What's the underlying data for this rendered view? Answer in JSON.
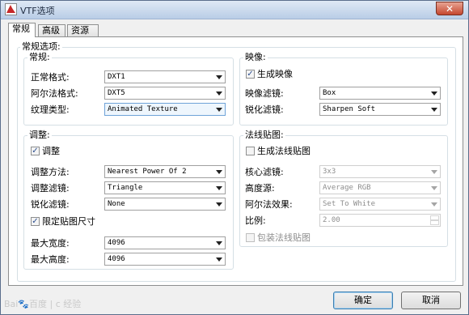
{
  "window": {
    "title": "VTF选项",
    "close": "✕"
  },
  "tabs": [
    {
      "label": "常规",
      "active": true
    },
    {
      "label": "高级",
      "active": false
    },
    {
      "label": "资源",
      "active": false
    }
  ],
  "general_options": {
    "title": "常规选项:",
    "general": {
      "title": "常规:",
      "normal_format_label": "正常格式:",
      "normal_format_value": "DXT1",
      "alpha_format_label": "阿尔法格式:",
      "alpha_format_value": "DXT5",
      "texture_type_label": "纹理类型:",
      "texture_type_value": "Animated Texture"
    },
    "mipmap": {
      "title": "映像:",
      "generate_label": "生成映像",
      "generate_checked": true,
      "filter_label": "映像滤镜:",
      "filter_value": "Box",
      "sharpen_label": "锐化滤镜:",
      "sharpen_value": "Sharpen Soft"
    },
    "resize": {
      "title": "调整:",
      "resize_label": "调整",
      "resize_checked": true,
      "method_label": "调整方法:",
      "method_value": "Nearest Power Of 2",
      "filter_label": "调整滤镜:",
      "filter_value": "Triangle",
      "sharpen_label": "锐化滤镜:",
      "sharpen_value": "None",
      "clamp_label": "限定贴图尺寸",
      "clamp_checked": true,
      "max_width_label": "最大宽度:",
      "max_width_value": "4096",
      "max_height_label": "最大高度:",
      "max_height_value": "4096"
    },
    "normal_map": {
      "title": "法线贴图:",
      "generate_label": "生成法线贴图",
      "generate_checked": false,
      "kernel_label": "核心滤镜:",
      "kernel_value": "3x3",
      "height_source_label": "高度源:",
      "height_source_value": "Average RGB",
      "alpha_effect_label": "阿尔法效果:",
      "alpha_effect_value": "Set To White",
      "scale_label": "比例:",
      "scale_value": "2.00",
      "wrap_label": "包装法线贴图",
      "wrap_checked": false
    }
  },
  "buttons": {
    "ok": "确定",
    "cancel": "取消"
  },
  "watermark": {
    "brand": "Bai",
    "paw": "🐾",
    "site": "百度",
    "separator": "|",
    "sub": "c 经验"
  },
  "colors": {
    "accent": "#3c7fb1",
    "checkmark": "#2a4d8f"
  }
}
